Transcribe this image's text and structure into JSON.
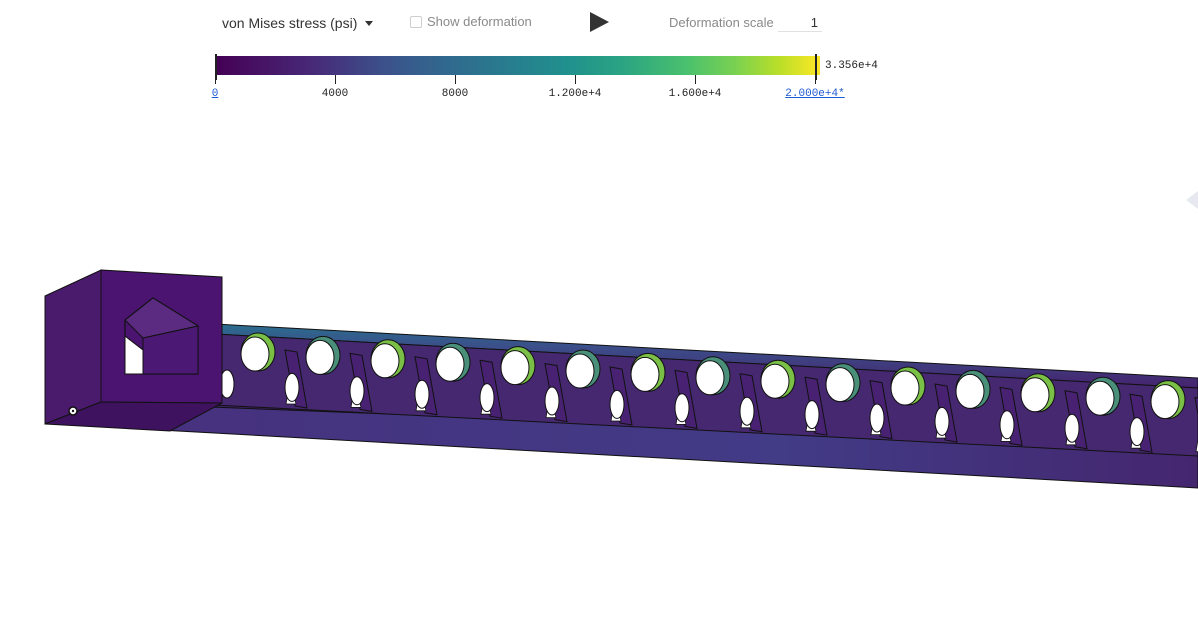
{
  "toolbar": {
    "result_type": "von Mises stress (psi)",
    "show_deformation_label": "Show deformation",
    "show_deformation_checked": false,
    "deformation_scale_label": "Deformation scale",
    "deformation_scale_value": "1"
  },
  "legend": {
    "ticks": [
      "0",
      "4000",
      "8000",
      "1.200e+4",
      "1.600e+4",
      "2.000e+4*"
    ],
    "max_value": "3.356e+4",
    "colormap": "viridis"
  },
  "model": {
    "description_color_min": "#440154",
    "description_color_max": "#fde725"
  }
}
